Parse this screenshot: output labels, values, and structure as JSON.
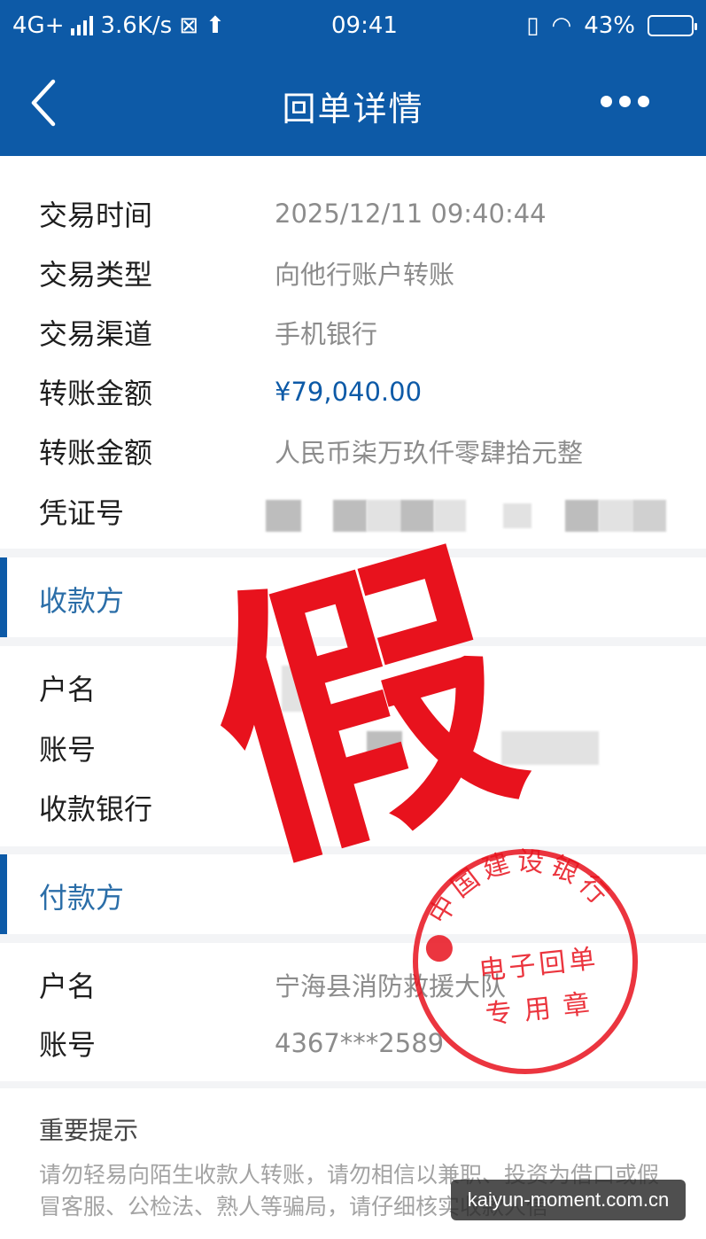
{
  "status_bar": {
    "network": "4G+",
    "speed": "3.6K/s",
    "time": "09:41",
    "battery": "43%",
    "battery_level": 0.43
  },
  "header": {
    "title": "回单详情"
  },
  "transaction": {
    "rows": [
      {
        "label": "交易时间",
        "value": "2025/12/11  09:40:44"
      },
      {
        "label": "交易类型",
        "value": "向他行账户转账"
      },
      {
        "label": "交易渠道",
        "value": "手机银行"
      },
      {
        "label": "转账金额",
        "value": "¥79,040.00"
      },
      {
        "label": "转账金额",
        "value": "人民币柒万玖仟零肆拾元整"
      },
      {
        "label": "凭证号",
        "value": ""
      }
    ]
  },
  "payee": {
    "title": "收款方",
    "rows": [
      {
        "label": "户名",
        "value": ""
      },
      {
        "label": "账号",
        "value": ""
      },
      {
        "label": "收款银行",
        "value": ""
      }
    ]
  },
  "payer": {
    "title": "付款方",
    "rows": [
      {
        "label": "户名",
        "value": "宁海县消防救援大队"
      },
      {
        "label": "账号",
        "value": "4367***2589"
      }
    ]
  },
  "notice": {
    "title": "重要提示",
    "text": "请勿轻易向陌生收款人转账，请勿相信以兼职、投资为借口或假冒客服、公检法、熟人等骗局，请仔细核实收款人信"
  },
  "overlay": {
    "fake_mark": "假",
    "stamp_bank": "中国建设银行",
    "stamp_line1": "电子回单",
    "stamp_line2": "专用章"
  },
  "watermark": "kaiyun-moment.com.cn",
  "colors": {
    "brand_blue": "#0d5aa7",
    "stamp_red": "#e8121d"
  }
}
